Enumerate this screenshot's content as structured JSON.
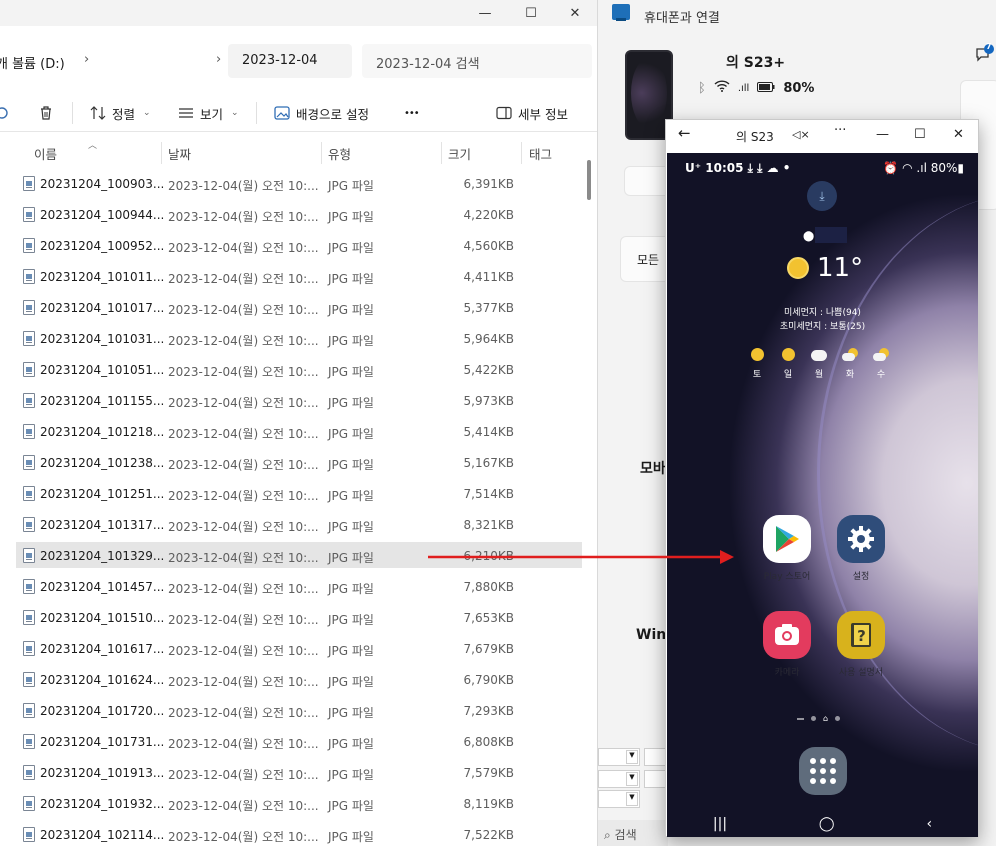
{
  "explorer": {
    "address": {
      "drive_crumb": "리볼륨 (D:)",
      "drive_crumb_visible": "개 볼륨 (D:)",
      "folder": "2023-12-04",
      "search_placeholder": "2023-12-04 검색"
    },
    "toolbar": {
      "sort_label": "정렬",
      "view_label": "보기",
      "set_background_label": "배경으로 설정",
      "more_label": "•••",
      "details_label": "세부 정보"
    },
    "columns": {
      "name": "이름",
      "date": "날짜",
      "type": "유형",
      "size": "크기",
      "tags": "태그"
    },
    "files": [
      {
        "name": "20231204_100903...",
        "date": "2023-12-04(월) 오전 10:...",
        "type": "JPG 파일",
        "size": "6,391KB"
      },
      {
        "name": "20231204_100944...",
        "date": "2023-12-04(월) 오전 10:...",
        "type": "JPG 파일",
        "size": "4,220KB"
      },
      {
        "name": "20231204_100952...",
        "date": "2023-12-04(월) 오전 10:...",
        "type": "JPG 파일",
        "size": "4,560KB"
      },
      {
        "name": "20231204_101011...",
        "date": "2023-12-04(월) 오전 10:...",
        "type": "JPG 파일",
        "size": "4,411KB"
      },
      {
        "name": "20231204_101017...",
        "date": "2023-12-04(월) 오전 10:...",
        "type": "JPG 파일",
        "size": "5,377KB"
      },
      {
        "name": "20231204_101031...",
        "date": "2023-12-04(월) 오전 10:...",
        "type": "JPG 파일",
        "size": "5,964KB"
      },
      {
        "name": "20231204_101051...",
        "date": "2023-12-04(월) 오전 10:...",
        "type": "JPG 파일",
        "size": "5,422KB"
      },
      {
        "name": "20231204_101155...",
        "date": "2023-12-04(월) 오전 10:...",
        "type": "JPG 파일",
        "size": "5,973KB"
      },
      {
        "name": "20231204_101218...",
        "date": "2023-12-04(월) 오전 10:...",
        "type": "JPG 파일",
        "size": "5,414KB"
      },
      {
        "name": "20231204_101238...",
        "date": "2023-12-04(월) 오전 10:...",
        "type": "JPG 파일",
        "size": "5,167KB"
      },
      {
        "name": "20231204_101251...",
        "date": "2023-12-04(월) 오전 10:...",
        "type": "JPG 파일",
        "size": "7,514KB"
      },
      {
        "name": "20231204_101317...",
        "date": "2023-12-04(월) 오전 10:...",
        "type": "JPG 파일",
        "size": "8,321KB"
      },
      {
        "name": "20231204_101329...",
        "date": "2023-12-04(월) 오전 10:...",
        "type": "JPG 파일",
        "size": "6,210KB",
        "selected": true
      },
      {
        "name": "20231204_101457...",
        "date": "2023-12-04(월) 오전 10:...",
        "type": "JPG 파일",
        "size": "7,880KB"
      },
      {
        "name": "20231204_101510...",
        "date": "2023-12-04(월) 오전 10:...",
        "type": "JPG 파일",
        "size": "7,653KB"
      },
      {
        "name": "20231204_101617...",
        "date": "2023-12-04(월) 오전 10:...",
        "type": "JPG 파일",
        "size": "7,679KB"
      },
      {
        "name": "20231204_101624...",
        "date": "2023-12-04(월) 오전 10:...",
        "type": "JPG 파일",
        "size": "6,790KB"
      },
      {
        "name": "20231204_101720...",
        "date": "2023-12-04(월) 오전 10:...",
        "type": "JPG 파일",
        "size": "7,293KB"
      },
      {
        "name": "20231204_101731...",
        "date": "2023-12-04(월) 오전 10:...",
        "type": "JPG 파일",
        "size": "6,808KB"
      },
      {
        "name": "20231204_101913...",
        "date": "2023-12-04(월) 오전 10:...",
        "type": "JPG 파일",
        "size": "7,579KB"
      },
      {
        "name": "20231204_101932...",
        "date": "2023-12-04(월) 오전 10:...",
        "type": "JPG 파일",
        "size": "8,119KB"
      },
      {
        "name": "20231204_102114...",
        "date": "2023-12-04(월) 오전 10:...",
        "type": "JPG 파일",
        "size": "7,522KB"
      }
    ]
  },
  "phone_link": {
    "title": "휴대폰과 연결",
    "device_name": "의 S23+",
    "battery": "80%",
    "badge_count": "7",
    "all_label": "모든",
    "mobile_partial": "모바",
    "win_partial": "Win",
    "search_label": "검색"
  },
  "mirror": {
    "title": "의 S23",
    "status_left": "U⁺ 10:05 ⤓ ⤓ ☁ •",
    "status_right": "⏰ ◠ .ıl 80%▮",
    "temperature": "11°",
    "fine_dust": "미세먼지 : 나쁨(94)",
    "ultrafine_dust": "초미세먼지 : 보통(25)",
    "forecast": [
      {
        "day": "토",
        "icon": "sun-icon"
      },
      {
        "day": "일",
        "icon": "sun-icon"
      },
      {
        "day": "월",
        "icon": "cloud-icon"
      },
      {
        "day": "화",
        "icon": "partly-cloudy-icon"
      },
      {
        "day": "수",
        "icon": "partly-cloudy-icon"
      }
    ],
    "apps": {
      "play_store": "Play 스토어",
      "settings": "설정",
      "camera": "카메라",
      "manual": "사용 설명서"
    },
    "colors": {
      "camera_bg": "#e33b5e",
      "settings_bg": "#2f4d7a",
      "manual_bg": "#d8b21c",
      "arrow": "#e01e1e"
    }
  }
}
